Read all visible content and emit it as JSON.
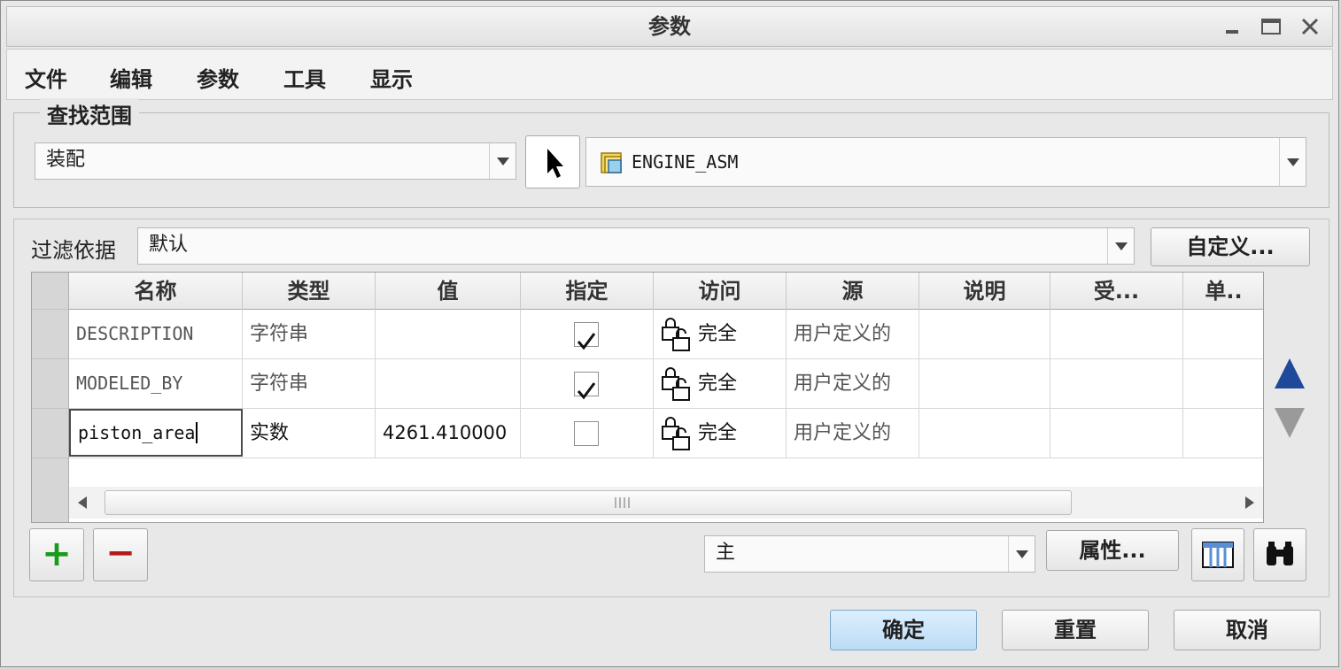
{
  "window": {
    "title": "参数"
  },
  "menu": {
    "items": [
      "文件",
      "编辑",
      "参数",
      "工具",
      "显示"
    ]
  },
  "find_scope": {
    "legend": "查找范围",
    "scope_value": "装配",
    "object_value": "ENGINE_ASM"
  },
  "filter": {
    "label": "过滤依据",
    "value": "默认",
    "customize_label": "自定义..."
  },
  "table": {
    "columns": [
      "名称",
      "类型",
      "值",
      "指定",
      "访问",
      "源",
      "说明",
      "受...",
      "单.."
    ],
    "rows": [
      {
        "name": "DESCRIPTION",
        "type": "字符串",
        "value": "",
        "designated": true,
        "access": "完全",
        "source": "用户定义的",
        "description": "",
        "restricted": "",
        "unit": ""
      },
      {
        "name": "MODELED_BY",
        "type": "字符串",
        "value": "",
        "designated": true,
        "access": "完全",
        "source": "用户定义的",
        "description": "",
        "restricted": "",
        "unit": ""
      },
      {
        "name": "piston_area",
        "type": "实数",
        "value": "4261.410000",
        "designated": false,
        "access": "完全",
        "source": "用户定义的",
        "description": "",
        "restricted": "",
        "unit": ""
      }
    ]
  },
  "bottom": {
    "add_label": "+",
    "remove_label": "−",
    "view_value": "主",
    "properties_label": "属性..."
  },
  "footer": {
    "ok_label": "确定",
    "reset_label": "重置",
    "cancel_label": "取消"
  },
  "colors": {
    "accent": "#cfe6f7",
    "green": "#1a9a1a",
    "red": "#b31b1b",
    "scroll_up": "#1f4a9a"
  }
}
